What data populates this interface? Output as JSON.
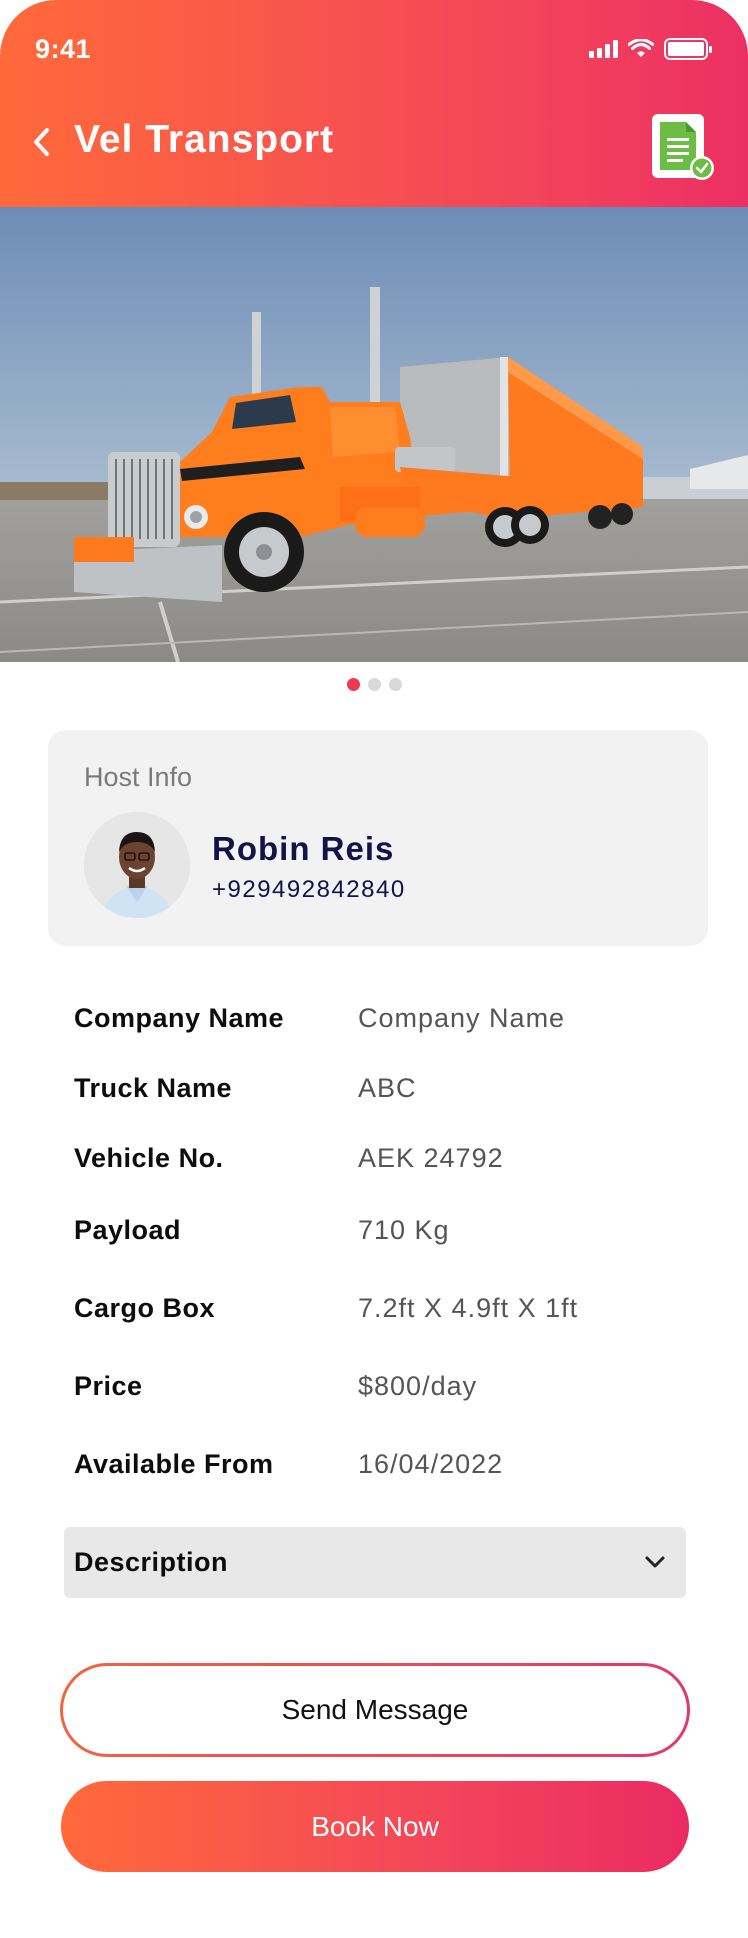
{
  "status_bar": {
    "time": "9:41"
  },
  "header": {
    "title": "Vel Transport"
  },
  "carousel": {
    "total": 3,
    "active_index": 0
  },
  "host": {
    "section_label": "Host Info",
    "name": "Robin Reis",
    "phone": "+929492842840"
  },
  "details": [
    {
      "label": "Company Name",
      "value": "Company Name"
    },
    {
      "label": "Truck Name",
      "value": "ABC"
    },
    {
      "label": "Vehicle No.",
      "value": "AEK 24792"
    },
    {
      "label": "Payload",
      "value": "710 Kg"
    },
    {
      "label": "Cargo Box",
      "value": "7.2ft X 4.9ft X 1ft"
    },
    {
      "label": "Price",
      "value": "$800/day"
    },
    {
      "label": "Available From",
      "value": "16/04/2022"
    }
  ],
  "description": {
    "label": "Description"
  },
  "actions": {
    "send_message": "Send Message",
    "book_now": "Book Now"
  },
  "colors": {
    "accent_start": "#ff6a3a",
    "accent_end": "#ec2f63",
    "host_name": "#15124a",
    "active_dot": "#ef3a53"
  }
}
